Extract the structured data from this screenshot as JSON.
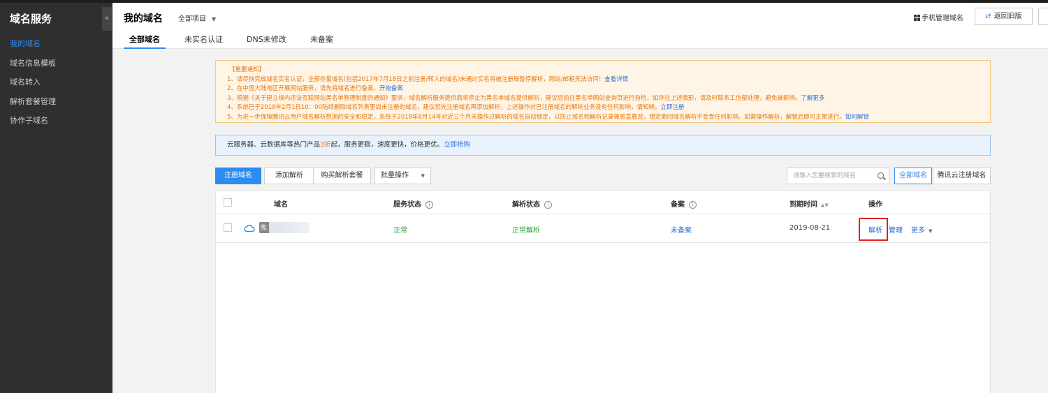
{
  "sidebar": {
    "brand": "域名服务",
    "collapse_glyph": "«",
    "items": [
      {
        "label": "我的域名",
        "active": true
      },
      {
        "label": "域名信息模板",
        "active": false
      },
      {
        "label": "域名转入",
        "active": false
      },
      {
        "label": "解析套餐管理",
        "active": false
      },
      {
        "label": "协作子域名",
        "active": false
      }
    ]
  },
  "header": {
    "title": "我的域名",
    "project": "全部项目",
    "mobile_manage": "手机管理域名",
    "back_old": "返回旧版",
    "tabs": [
      {
        "label": "全部域名",
        "active": true
      },
      {
        "label": "未实名认证",
        "active": false
      },
      {
        "label": "DNS未修改",
        "active": false
      },
      {
        "label": "未备案",
        "active": false
      }
    ]
  },
  "notice": {
    "heading": "【重要通知】",
    "lines": [
      {
        "text": "1、请尽快完成域名实名认证，全部存量域名(包括2017年7月18日之前注册/转入的域名)未通过实名将被注册局暂停解析，网站/邮箱无法访问！",
        "link": "查看详情"
      },
      {
        "text": "2、在中国大陆地区开展网站服务，请先将域名进行备案。",
        "link": "开始备案"
      },
      {
        "text": "3、根据《关于建立境内违法互联网站黑名单管理制度的通知》要求，域名解析服务提供商将停止为黑名单域名提供解析，建议您前往黑名单网站查询页进行自检，如存在上述情形，请及时联系工信部处理，避免被影响。",
        "link": "了解更多"
      },
      {
        "text": "4、系统已于2018年2月1日10：00陆续删除域名列表里尚未注册的域名，建议您先注册域名再添加解析，上述操作对已注册域名的解析业务没有任何影响，请知晓。",
        "link": "立即注册"
      },
      {
        "text": "5、为进一步保障腾讯云用户域名解析数据的安全和稳定，系统于2018年8月14号对近三个月未操作过解析的域名自动锁定，以防止域名和解析记录被恶意篡改，锁定期间域名解析不会受任何影响。如需操作解析，解锁后即可正常进行。",
        "link": "如何解锁"
      }
    ]
  },
  "promo": {
    "text_before": "云服务器、云数据库等热门产品",
    "highlight": "3折",
    "text_after": "起，服务更稳，速度更快，价格更优。",
    "link": "立即抢购"
  },
  "toolbar": {
    "register": "注册域名",
    "add_resolve": "添加解析",
    "buy_package": "购买解析套餐",
    "batch": "批量操作",
    "search_placeholder": "请输入您要搜索的域名",
    "filter_all": "全部域名",
    "filter_tencent": "腾讯云注册域名"
  },
  "table": {
    "columns": {
      "domain": "域名",
      "service_status": "服务状态",
      "resolve_status": "解析状态",
      "icp": "备案",
      "expire": "到期时间",
      "actions": "操作"
    },
    "rows": [
      {
        "domain_mark": "免",
        "service_status": "正常",
        "resolve_status": "正常解析",
        "icp": "未备案",
        "expire": "2019-08-21",
        "action_resolve": "解析",
        "action_manage": "管理",
        "action_more": "更多"
      }
    ]
  },
  "colors": {
    "accent": "#2d8cf0",
    "sidebar_bg": "#2f2f2f",
    "success": "#29a33a",
    "notice_text": "#e8770e",
    "highlight_box": "#e02020"
  }
}
